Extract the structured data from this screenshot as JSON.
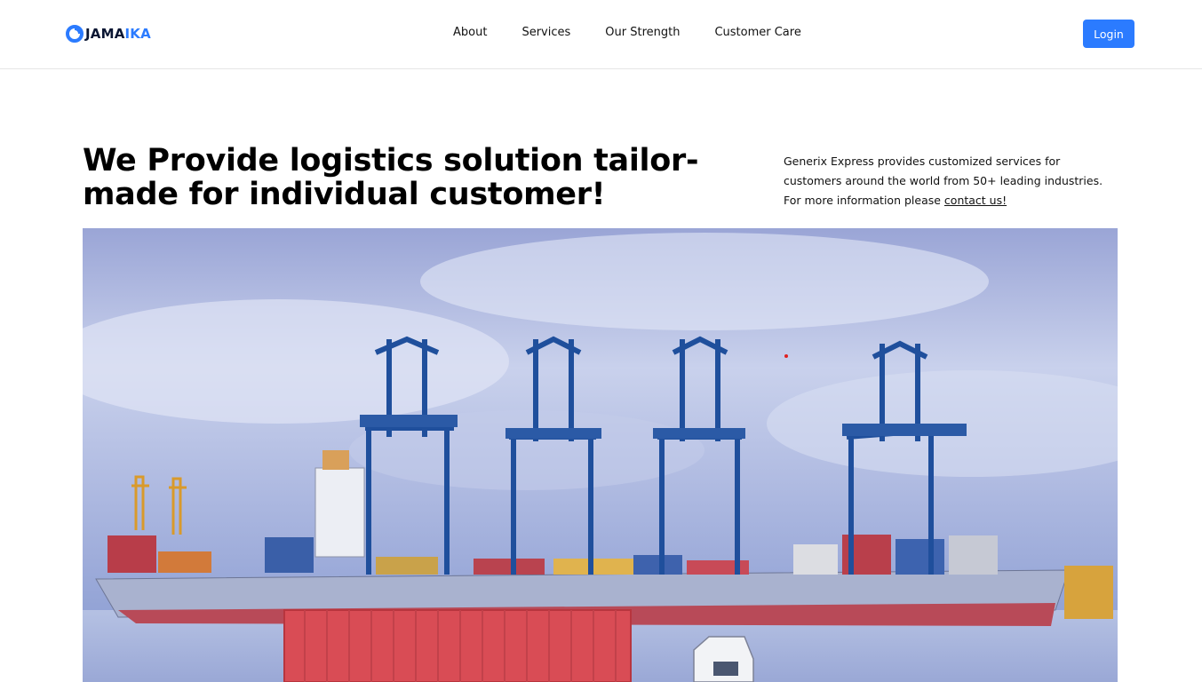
{
  "brand": {
    "name_part1": "JAMA",
    "name_part2": "IKA",
    "accent_color": "#2b7bff",
    "logo_icon": "circle-logo-icon"
  },
  "nav": {
    "items": [
      {
        "label": "About"
      },
      {
        "label": "Services"
      },
      {
        "label": "Our Strength"
      },
      {
        "label": "Customer Care"
      }
    ]
  },
  "header": {
    "login_label": "Login"
  },
  "hero": {
    "headline": "We Provide logistics solution tailor-made for individual customer!",
    "description": "Generix Express provides customized services for customers around the world from 50+ leading industries. For more information please ",
    "contact_link": "contact us!",
    "image_subject": "port-cranes-cargo-ship-image"
  }
}
